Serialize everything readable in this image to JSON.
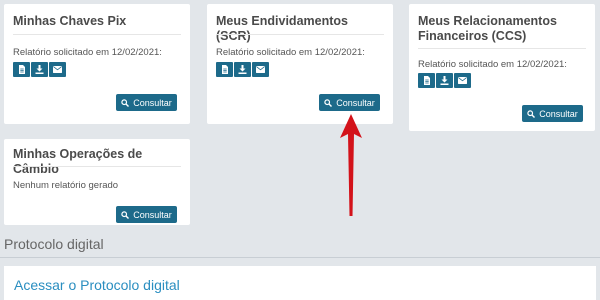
{
  "cards": [
    {
      "title": "Minhas Chaves Pix",
      "report_text": "Relatório solicitado em 12/02/2021:",
      "button_label": "Consultar",
      "icons": [
        "pdf-file-icon",
        "download-icon",
        "email-icon"
      ]
    },
    {
      "title": "Meus Endividamentos (SCR)",
      "report_text": "Relatório solicitado em 12/02/2021:",
      "button_label": "Consultar",
      "icons": [
        "pdf-file-icon",
        "download-icon",
        "email-icon"
      ]
    },
    {
      "title": "Meus Relacionamentos Financeiros (CCS)",
      "report_text": "Relatório solicitado em 12/02/2021:",
      "button_label": "Consultar",
      "icons": [
        "pdf-file-icon",
        "download-icon",
        "email-icon"
      ]
    },
    {
      "title": "Minhas Operações de Câmbio",
      "report_text": "Nenhum relatório gerado",
      "button_label": "Consultar"
    }
  ],
  "protocol": {
    "section_title": "Protocolo digital",
    "link_text": "Acessar o Protocolo digital"
  },
  "colors": {
    "page_background": "#e2e6ea",
    "button": "#1d6a8a",
    "arrow": "#d3121a",
    "link": "#2a8ec0"
  }
}
